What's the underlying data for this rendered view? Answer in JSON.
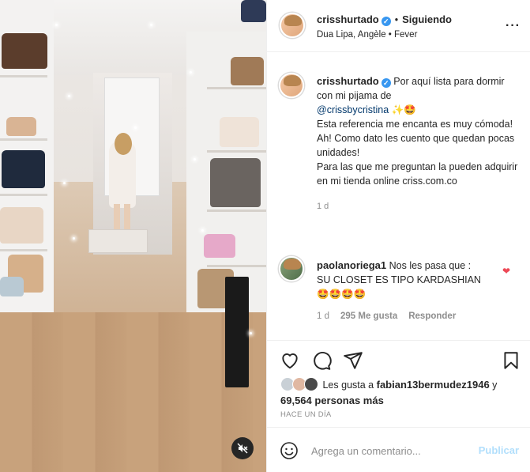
{
  "post": {
    "username": "crisshurtado",
    "follow_status": "Siguiendo",
    "subtitle": "Dua Lipa, Angèle • Fever"
  },
  "caption": {
    "username": "crisshurtado",
    "line_1": "Por aquí lista para dormir con mi pijama de",
    "mention": "@crissbycristina",
    "emojis": "✨🤩",
    "line_2": "Esta referencia me encanta es muy cómoda!",
    "line_3": "Ah! Como dato les cuento que quedan pocas unidades!",
    "line_4": "Para las que me preguntan la pueden adquirir en mi tienda online criss.com.co",
    "time": "1 d"
  },
  "comment": {
    "username": "paolanoriega1",
    "text_1": "Nos les pasa que :",
    "text_2": "SU CLOSET ES TIPO KARDASHIAN",
    "emojis": "🤩🤩🤩🤩",
    "time": "1 d",
    "likes": "295 Me gusta",
    "reply_label": "Responder"
  },
  "likes_summary": {
    "prefix": "Les gusta a",
    "user": "fabian13bermudez1946",
    "connector": "y",
    "count": "69,564 personas más"
  },
  "timestamp": "HACE UN DÍA",
  "comment_box": {
    "placeholder": "Agrega un comentario...",
    "publish_label": "Publicar"
  },
  "icons": {
    "like": "heart-icon",
    "comment": "comment-icon",
    "share": "share-icon",
    "save": "bookmark-icon",
    "mute": "mute-icon",
    "emoji": "emoji-icon"
  },
  "colors": {
    "verified": "#3897f0",
    "mention": "#00376b",
    "muted_text": "#8e8e8e",
    "publish_disabled": "#b2dffc",
    "like_red": "#ed4956"
  }
}
